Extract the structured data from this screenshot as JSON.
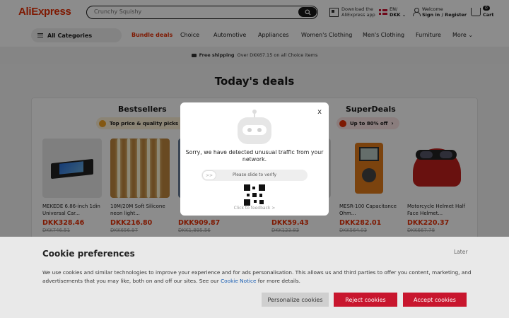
{
  "header": {
    "logo": "AliExpress",
    "search_placeholder": "Crunchy Squishy",
    "app_line1": "Download the",
    "app_line2": "AliExpress app",
    "lang_line1": "EN/",
    "lang_line2": "DKK",
    "welcome": "Welcome",
    "signin": "Sign in / Register",
    "cart_count": "0",
    "cart_label": "Cart"
  },
  "nav": {
    "all_categories": "All Categories",
    "items": [
      "Bundle deals",
      "Choice",
      "Automotive",
      "Appliances",
      "Women's Clothing",
      "Men's Clothing",
      "Furniture",
      "More"
    ]
  },
  "shipping": {
    "bold": "Free shipping",
    "rest": "Over DKK67.15 on all Choice items"
  },
  "main": {
    "title": "Today's deals",
    "bestsellers": {
      "title": "Bestsellers",
      "pill": "Top price & quality picks"
    },
    "superdeals": {
      "title": "SuperDeals",
      "pill": "Up to 80% off"
    },
    "products": [
      {
        "name": "MEKEDE 6.86-inch 1din Universal Car...",
        "price": "DKK328.46",
        "old": "DKK746.51"
      },
      {
        "name": "10M/20M Soft Silicone neon light...",
        "price": "DKK216.80",
        "old": "DKK656.97"
      },
      {
        "name": "",
        "price": "DKK909.87",
        "old": "DKK1,895.56"
      },
      {
        "name": "",
        "price": "DKK59.43",
        "old": "DKK123.83"
      },
      {
        "name": "MESR-100 Capacitance Ohm...",
        "price": "DKK282.01",
        "old": "DKK564.03"
      },
      {
        "name": "Motorcycle Helmet Half Face Helmet...",
        "price": "DKK220.37",
        "old": "DKK667.78"
      }
    ]
  },
  "modal": {
    "close": "x",
    "message": "Sorry, we have detected unusual traffic from your network.",
    "slider": "Please slide to verify",
    "knob": ">>",
    "feedback": "Click to feedback >"
  },
  "cookie": {
    "title": "Cookie preferences",
    "later": "Later",
    "text_before": "We use cookies and similar technologies to improve your experience and for ads personalisation. This allows us and third parties to offer you content, marketing, and advertisements that you may like, both on and off our sites. See our ",
    "link": "Cookie Notice",
    "text_after": " for more details.",
    "personalize": "Personalize cookies",
    "reject": "Reject cookies",
    "accept": "Accept cookies"
  },
  "colors": {
    "brand_red": "#e62e04",
    "cookie_red": "#c8162e"
  }
}
